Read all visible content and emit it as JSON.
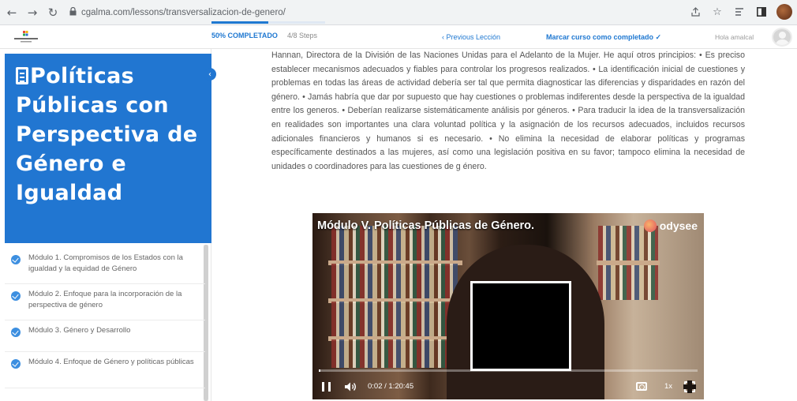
{
  "browser": {
    "url": "cgalma.com/lessons/transversalizacion-de-genero/",
    "back_icon": "←",
    "forward_icon": "→",
    "reload_icon": "↻",
    "lock_icon": "🔒"
  },
  "course_bar": {
    "progress_label": "50% COMPLETADO",
    "progress_fraction": 0.5,
    "steps_label": "4/8 Steps",
    "prev_lesson_label": "‹  Previous Lección",
    "mark_complete_label": "Marcar curso como completado ✓",
    "user_greeting": "Hola amalcal",
    "accent_color": "#1f78d1"
  },
  "sidebar": {
    "course_title": "Políticas Públicas con Perspectiva de Género e Igualdad",
    "title_bg_color": "#2176d1",
    "collapse_icon": "‹",
    "modules": [
      {
        "label": "Módulo 1. Compromisos de los Estados con la igualdad y la equidad de Género"
      },
      {
        "label": "Módulo 2. Enfoque para la incorporación de la perspectiva de género"
      },
      {
        "label": "Módulo 3. Género y Desarrollo"
      },
      {
        "label": "Módulo 4. Enfoque de Género y políticas públicas"
      }
    ]
  },
  "lesson": {
    "paragraph": "Hannan, Directora de la División de las Naciones Unidas para el Adelanto de la Mujer. He aquí otros principios: • Es preciso establecer mecanismos adecuados y fiables para controlar los progresos realizados. • La identificación inicial de cuestiones y problemas en todas las áreas de actividad debería ser tal que permita diagnosticar las diferencias y disparidades en razón del género. • Jamás habría que dar por supuesto que hay cuestiones o problemas indiferentes desde la perspectiva de la igualdad entre los generos. • Deberían realizarse sistemáticamente análisis por géneros. • Para traducir la idea de la transversalización en realidades son importantes una clara voluntad política y la asignación de los recursos adecuados, incluidos recursos adicionales financieros y humanos si es necesario. • No elimina la necesidad de elaborar políticas y programas específicamente destinados a las mujeres, así como una legislación positiva en su favor; tampoco elimina la necesidad de unidades o coordinadores para las cuestiones de g énero."
  },
  "video": {
    "title": "Módulo V. Políticas Públicas de Género.",
    "brand": "odysee",
    "time": "0:02 / 1:20:45",
    "speed": "1x",
    "played_fraction": 0.003
  }
}
